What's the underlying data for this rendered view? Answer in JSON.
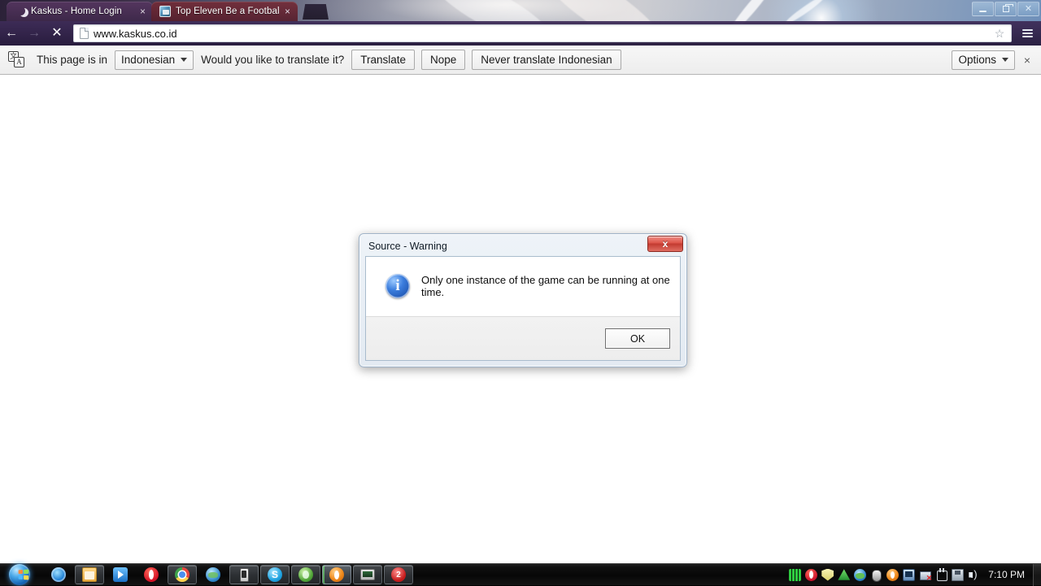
{
  "browser": {
    "tabs": [
      {
        "title": "Kaskus - Home Login",
        "favicon": "moon-icon",
        "close": "×"
      },
      {
        "title": "Top Eleven Be a Football M",
        "favicon": "top-eleven-icon",
        "close": "×"
      }
    ],
    "new_tab_label": "",
    "window_controls": {
      "minimize": "",
      "restore": "",
      "close": "✕"
    },
    "nav": {
      "back": "←",
      "forward": "→",
      "stop": "✕",
      "url": "www.kaskus.co.id",
      "bookmark_star": "☆",
      "menu": "menu-icon"
    }
  },
  "infobar": {
    "icon": "translate-icon",
    "icon_glyphs": {
      "source": "文",
      "target": "A"
    },
    "prefix_text": "This page is in",
    "language": "Indonesian",
    "question_text": "Would you like to translate it?",
    "translate_button": "Translate",
    "nope_button": "Nope",
    "never_button": "Never translate Indonesian",
    "options_button": "Options",
    "close": "×"
  },
  "dialog": {
    "title": "Source - Warning",
    "close_glyph": "x",
    "icon": "info-icon",
    "message": "Only one instance of the game can be running at one time.",
    "ok_button": "OK"
  },
  "taskbar": {
    "start": "start-orb",
    "items": [
      {
        "name": "internet-explorer",
        "style": "ico-ie",
        "box": "none"
      },
      {
        "name": "windows-explorer",
        "style": "ico-folder",
        "box": "pinned-box"
      },
      {
        "name": "windows-media-player",
        "style": "ico-wmp",
        "box": "none"
      },
      {
        "name": "opera",
        "style": "ico-opera",
        "box": "none"
      },
      {
        "name": "google-chrome",
        "style": "ico-chrome",
        "box": "pinned-box"
      },
      {
        "name": "browser-globe",
        "style": "ico-globe",
        "box": "none"
      },
      {
        "name": "mobile-device-app",
        "style": "ico-phone",
        "box": "pinned-box"
      },
      {
        "name": "skype",
        "style": "ico-skype",
        "box": "pinned-box"
      },
      {
        "name": "green-app",
        "style": "ico-green",
        "box": "pinned-box"
      },
      {
        "name": "orange-app",
        "style": "ico-orange",
        "box": "active-box"
      },
      {
        "name": "monitor-app",
        "style": "ico-monitor",
        "box": "pinned-box"
      },
      {
        "name": "red-app",
        "style": "ico-red",
        "box": "pinned-box"
      }
    ],
    "tray_icons": [
      {
        "name": "grid-tray-icon",
        "style": "t-grid"
      },
      {
        "name": "opera-tray-icon",
        "style": "t-opera"
      },
      {
        "name": "shield-tray-icon",
        "style": "t-shield"
      },
      {
        "name": "triangle-tray-icon",
        "style": "t-tri"
      },
      {
        "name": "globe-tray-icon",
        "style": "t-earth"
      },
      {
        "name": "mouse-tray-icon",
        "style": "t-mouse"
      },
      {
        "name": "orange-tray-icon",
        "style": "t-orange"
      },
      {
        "name": "screen-tray-icon",
        "style": "t-screen"
      },
      {
        "name": "network-disconnected-icon",
        "style": "t-net"
      },
      {
        "name": "safely-remove-hardware-icon",
        "style": "t-plug"
      },
      {
        "name": "save-tray-icon",
        "style": "t-save"
      },
      {
        "name": "volume-icon",
        "style": "t-vol"
      }
    ],
    "clock": "7:10 PM"
  },
  "colors": {
    "dialog_title_text": "#101b26",
    "close_button_red": "#c23a30",
    "info_blue": "#13439c",
    "accent_purple": "#3a2c5c",
    "taskbar_black": "#0a0a0a"
  }
}
